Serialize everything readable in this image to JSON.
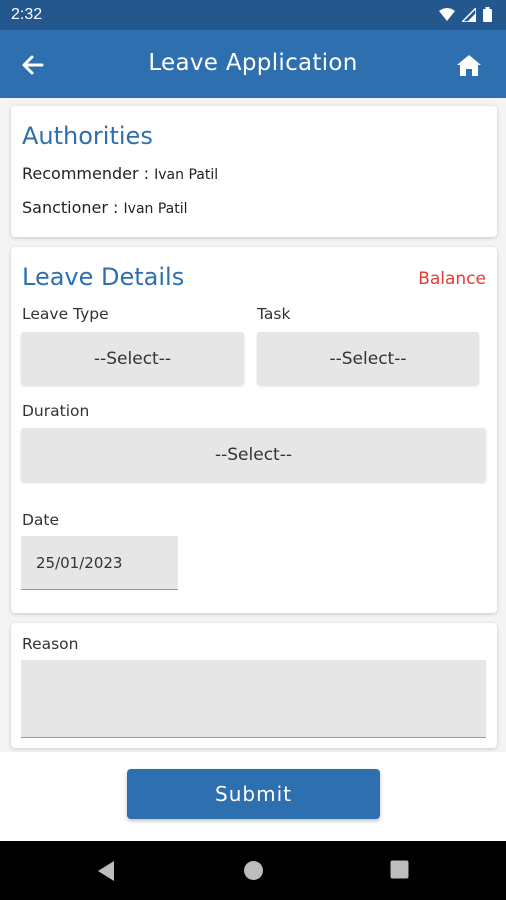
{
  "status_bar": {
    "time": "2:32",
    "icons": [
      "wifi-icon",
      "signal-icon",
      "battery-icon"
    ]
  },
  "app_bar": {
    "title": "Leave Application",
    "back_icon": "arrow-left-icon",
    "home_icon": "home-icon"
  },
  "authorities": {
    "title": "Authorities",
    "recommender_label": "Recommender : ",
    "recommender_value": "Ivan Patil",
    "sanctioner_label": "Sanctioner : ",
    "sanctioner_value": "Ivan Patil"
  },
  "leave_details": {
    "title": "Leave Details",
    "balance_link": "Balance",
    "leave_type_label": "Leave Type",
    "leave_type_value": "--Select--",
    "task_label": "Task",
    "task_value": "--Select--",
    "duration_label": "Duration",
    "duration_value": "--Select--",
    "date_label": "Date",
    "date_value": "25/01/2023"
  },
  "reason": {
    "label": "Reason",
    "value": ""
  },
  "submit_label": "Submit",
  "colors": {
    "primary": "#2e6faf",
    "status_bar": "#25578f",
    "balance": "#e53935"
  }
}
